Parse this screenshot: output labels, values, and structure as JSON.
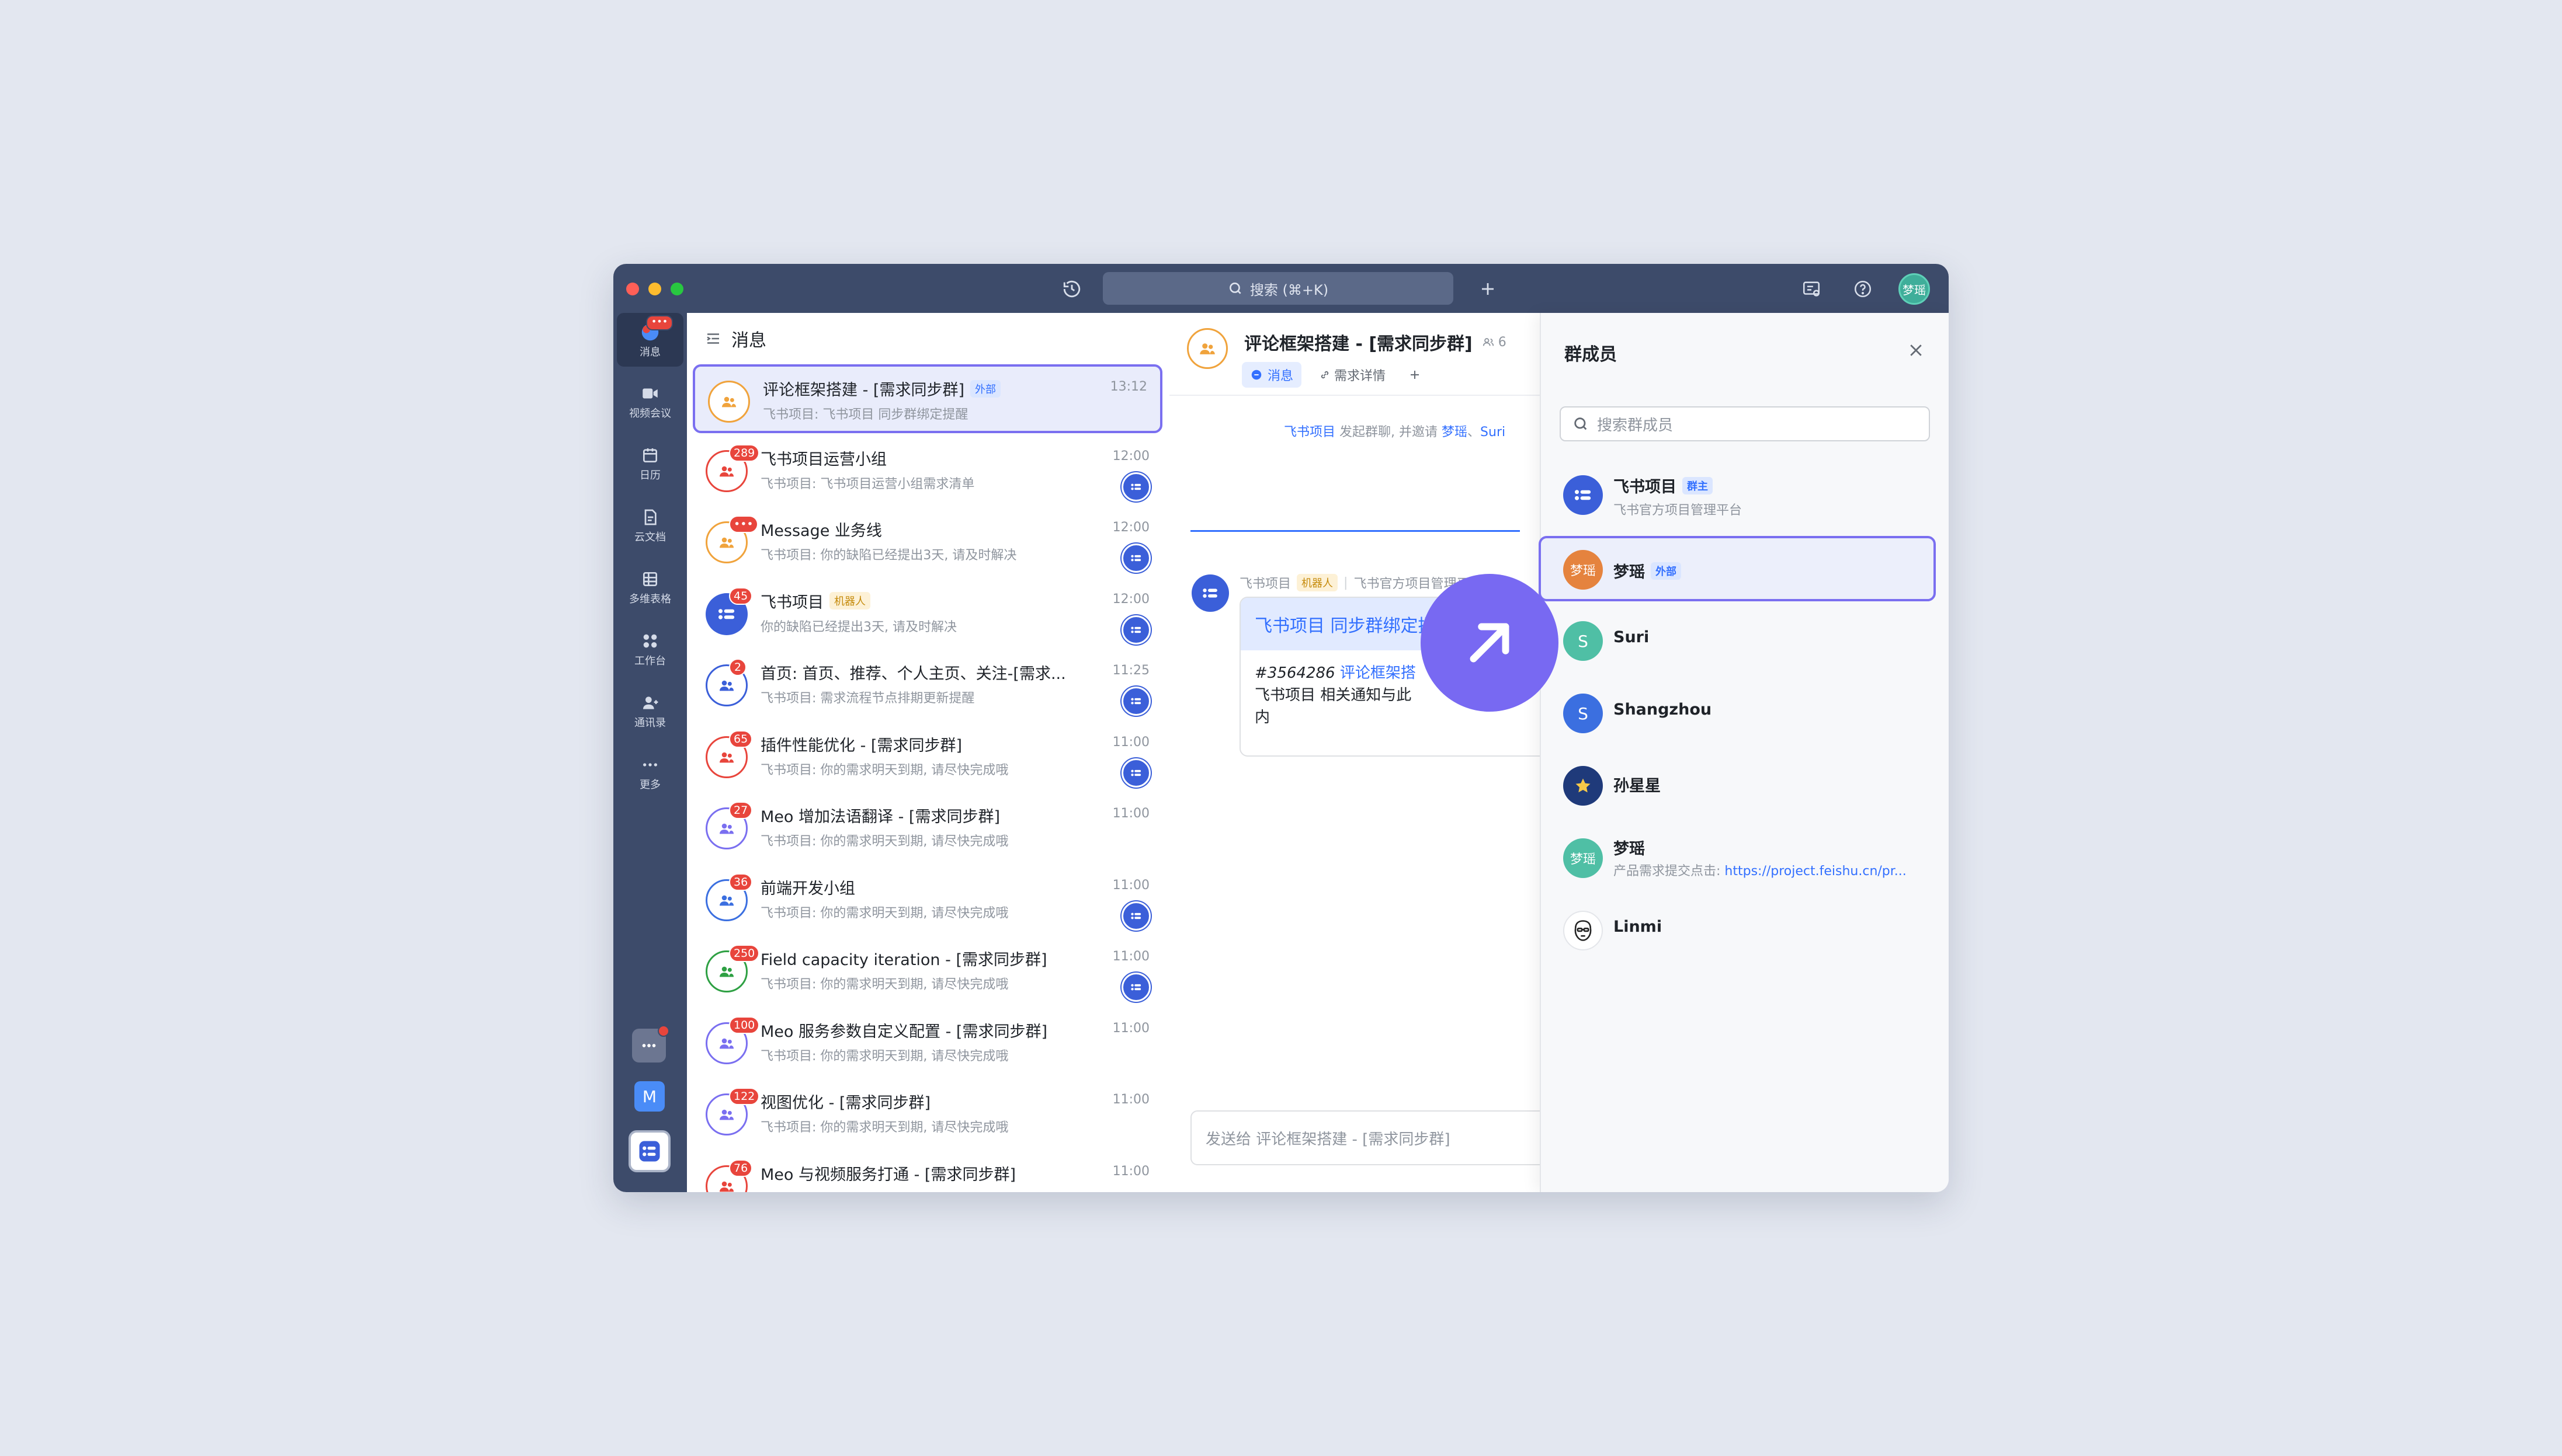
{
  "titlebar": {
    "search_placeholder": "搜索 (⌘+K)",
    "user_avatar": "梦瑶"
  },
  "rail": {
    "items": [
      {
        "label": "消息"
      },
      {
        "label": "视频会议"
      },
      {
        "label": "日历"
      },
      {
        "label": "云文档"
      },
      {
        "label": "多维表格"
      },
      {
        "label": "工作台"
      },
      {
        "label": "通讯录"
      },
      {
        "label": "更多"
      }
    ],
    "badge_more": "•••",
    "app_m": "M"
  },
  "list": {
    "title": "消息",
    "rows": [
      {
        "title": "评论框架搭建 - [需求同步群]",
        "tag": "外部",
        "sub": "飞书项目: 飞书项目 同步群绑定提醒",
        "time": "13:12",
        "badge": ""
      },
      {
        "title": "飞书项目运营小组",
        "tag": "",
        "sub": "飞书项目: 飞书项目运营小组需求清单",
        "time": "12:00",
        "badge": "289"
      },
      {
        "title": "Message 业务线",
        "tag": "",
        "sub": "飞书项目: 你的缺陷已经提出3天, 请及时解决",
        "time": "12:00",
        "badge": "•••"
      },
      {
        "title": "飞书项目",
        "tag": "机器人",
        "sub": "你的缺陷已经提出3天, 请及时解决",
        "time": "12:00",
        "badge": "45"
      },
      {
        "title": "首页: 首页、推荐、个人主页、关注-[需求...",
        "tag": "",
        "sub": "飞书项目: 需求流程节点排期更新提醒",
        "time": "11:25",
        "badge": "2"
      },
      {
        "title": "插件性能优化 - [需求同步群]",
        "tag": "",
        "sub": "飞书项目: 你的需求明天到期, 请尽快完成哦",
        "time": "11:00",
        "badge": "65"
      },
      {
        "title": "Meo 增加法语翻译 - [需求同步群]",
        "tag": "",
        "sub": "飞书项目: 你的需求明天到期, 请尽快完成哦",
        "time": "11:00",
        "badge": "27"
      },
      {
        "title": "前端开发小组",
        "tag": "",
        "sub": "飞书项目: 你的需求明天到期, 请尽快完成哦",
        "time": "11:00",
        "badge": "36"
      },
      {
        "title": "Field capacity iteration - [需求同步群]",
        "tag": "",
        "sub": "飞书项目: 你的需求明天到期, 请尽快完成哦",
        "time": "11:00",
        "badge": "250"
      },
      {
        "title": "Meo 服务参数自定义配置 - [需求同步群]",
        "tag": "",
        "sub": "飞书项目: 你的需求明天到期, 请尽快完成哦",
        "time": "11:00",
        "badge": "100"
      },
      {
        "title": "视图优化 - [需求同步群]",
        "tag": "",
        "sub": "飞书项目: 你的需求明天到期, 请尽快完成哦",
        "time": "11:00",
        "badge": "122"
      },
      {
        "title": "Meo 与视频服务打通 - [需求同步群]",
        "tag": "",
        "sub": "",
        "time": "11:00",
        "badge": "76"
      }
    ]
  },
  "chat": {
    "title": "评论框架搭建 - [需求同步群]",
    "member_count": "6",
    "tab_messages": "消息",
    "tab_detail": "需求详情",
    "system_sender": "飞书项目",
    "system_text": "发起群聊, 并邀请",
    "system_user1": "梦瑶",
    "system_user2": "Suri",
    "msg_sender": "飞书项目",
    "msg_tag": "机器人",
    "msg_source": "飞书官方项目管理平台",
    "card_title": "飞书项目 同步群绑定提醒",
    "card_id": "#3564286",
    "card_link": "评论框架搭",
    "card_body1": "飞书项目 相关通知与此",
    "card_body2": "内",
    "input_placeholder": "发送给 评论框架搭建 - [需求同步群]"
  },
  "panel": {
    "title": "群成员",
    "search_placeholder": "搜索群成员",
    "members": [
      {
        "name": "飞书项目",
        "tag": "群主",
        "desc": "飞书官方项目管理平台"
      },
      {
        "name": "梦瑶",
        "tag": "外部",
        "desc": "",
        "avatar": "梦瑶"
      },
      {
        "name": "Suri",
        "tag": "",
        "desc": "",
        "avatar": "S"
      },
      {
        "name": "Shangzhou",
        "tag": "",
        "desc": "",
        "avatar": "S"
      },
      {
        "name": "孙星星",
        "tag": "",
        "desc": ""
      },
      {
        "name": "梦瑶",
        "tag": "",
        "desc_prefix": "产品需求提交点击: ",
        "desc_link": "https://project.feishu.cn/pr...",
        "avatar": "梦瑶"
      },
      {
        "name": "Linmi",
        "tag": "",
        "desc": ""
      }
    ]
  },
  "colors": {
    "accent": "#7869f2",
    "brand_blue": "#3370ff",
    "dark_rail": "#3d4b6a"
  }
}
